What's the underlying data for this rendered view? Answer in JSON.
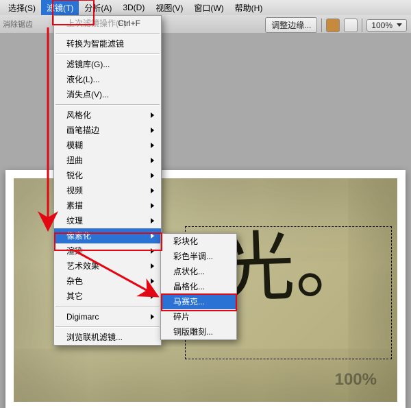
{
  "menubar": {
    "items": [
      {
        "label": "选择(S)"
      },
      {
        "label": "滤镜(T)"
      },
      {
        "label": "分析(A)"
      },
      {
        "label": "3D(D)"
      },
      {
        "label": "视图(V)"
      },
      {
        "label": "窗口(W)"
      },
      {
        "label": "帮助(H)"
      }
    ],
    "open_index": 1
  },
  "optbar": {
    "left_hint": "消除锯齿",
    "refine": "调整边缘...",
    "zoom": "100%"
  },
  "filter_menu": {
    "last": {
      "label": "上次滤镜操作(F)",
      "shortcut": "Ctrl+F"
    },
    "smart": "转换为智能滤镜",
    "gallery": "滤镜库(G)...",
    "liquify": "液化(L)...",
    "vanish": "消失点(V)...",
    "groups": [
      "风格化",
      "画笔描边",
      "模糊",
      "扭曲",
      "锐化",
      "视频",
      "素描",
      "纹理",
      "像素化",
      "渲染",
      "艺术效果",
      "杂色",
      "其它"
    ],
    "digimarc": "Digimarc",
    "online": "浏览联机滤镜..."
  },
  "pixelate_submenu": [
    "彩块化",
    "彩色半调...",
    "点状化...",
    "晶格化...",
    "马赛克...",
    "碎片",
    "铜版雕刻..."
  ],
  "pixelate_sel_index": 4,
  "canvas": {
    "handwriting": "年光。",
    "zoom_badge": "100%"
  }
}
